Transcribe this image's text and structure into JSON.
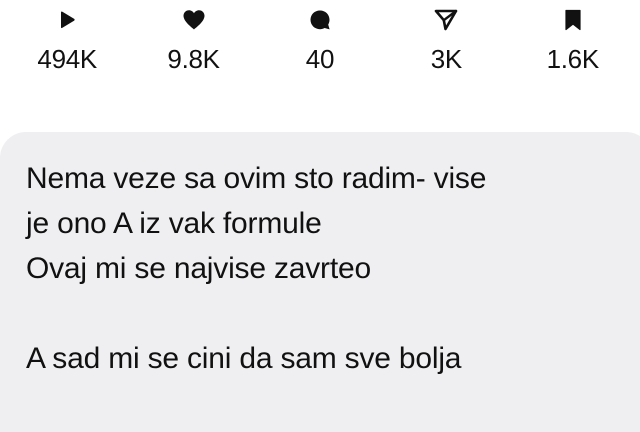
{
  "stats": [
    {
      "icon": "play-icon",
      "count": "494K"
    },
    {
      "icon": "heart-icon",
      "count": "9.8K"
    },
    {
      "icon": "comment-icon",
      "count": "40"
    },
    {
      "icon": "send-icon",
      "count": "3K"
    },
    {
      "icon": "bookmark-icon",
      "count": "1.6K"
    }
  ],
  "message": {
    "lines": [
      "Nema veze sa ovim sto radim- vise",
      "je ono A iz vak formule",
      "Ovaj mi se najvise zavrteo",
      "",
      "A sad mi se cini da sam sve bolja"
    ]
  },
  "colors": {
    "bubble_background": "#efeff2",
    "text": "#111111",
    "icon": "#111111"
  }
}
